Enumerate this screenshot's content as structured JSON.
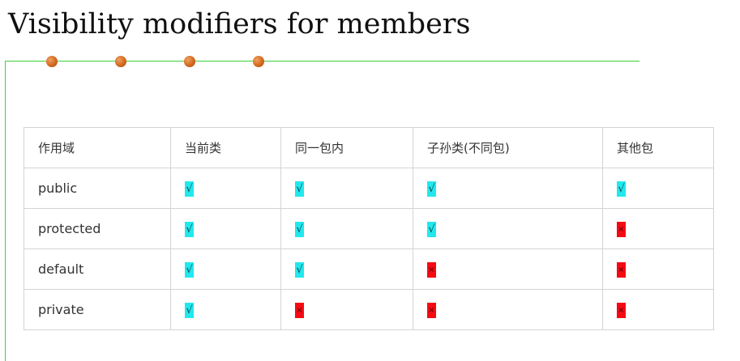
{
  "title": "Visibility modifiers for members",
  "table": {
    "headers": [
      "作用域",
      "当前类",
      "同一包内",
      "子孙类(不同包)",
      "其他包"
    ],
    "rows": [
      {
        "label": "public",
        "cells": [
          {
            "value": true,
            "symbol": "√"
          },
          {
            "value": true,
            "symbol": "√"
          },
          {
            "value": true,
            "symbol": "√"
          },
          {
            "value": true,
            "symbol": "√"
          }
        ]
      },
      {
        "label": "protected",
        "cells": [
          {
            "value": true,
            "symbol": "√"
          },
          {
            "value": true,
            "symbol": "√"
          },
          {
            "value": true,
            "symbol": "√"
          },
          {
            "value": false,
            "symbol": "×"
          }
        ]
      },
      {
        "label": "default",
        "cells": [
          {
            "value": true,
            "symbol": "√"
          },
          {
            "value": true,
            "symbol": "√"
          },
          {
            "value": false,
            "symbol": "×"
          },
          {
            "value": false,
            "symbol": "×"
          }
        ]
      },
      {
        "label": "private",
        "cells": [
          {
            "value": true,
            "symbol": "√"
          },
          {
            "value": false,
            "symbol": "×"
          },
          {
            "value": false,
            "symbol": "×"
          },
          {
            "value": false,
            "symbol": "×"
          }
        ]
      }
    ]
  },
  "colors": {
    "yes_highlight": "#22e8ee",
    "no_highlight": "#f50a14",
    "decor_line": "#3fcf3f",
    "decor_dot": "#d2691e"
  }
}
